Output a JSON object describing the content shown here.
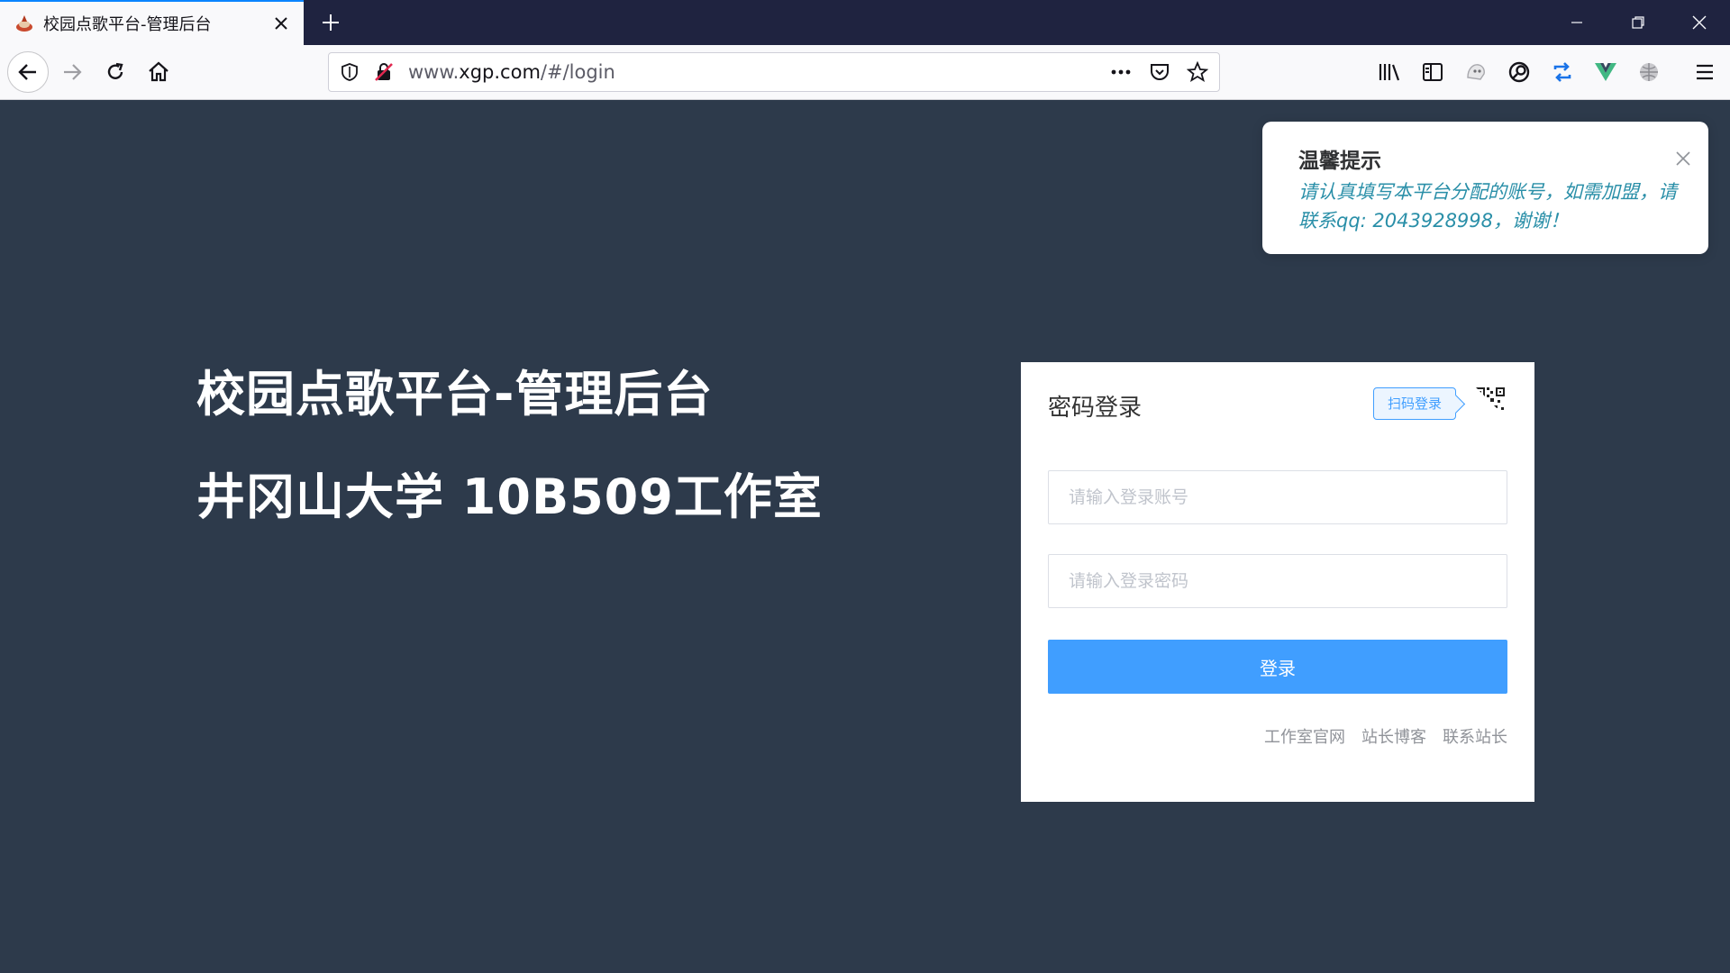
{
  "browser": {
    "tab": {
      "title": "校园点歌平台-管理后台"
    },
    "url": {
      "prefix": "www.",
      "host": "xgp.com",
      "path": "/#/login"
    }
  },
  "page": {
    "hero": {
      "title": "校园点歌平台-管理后台",
      "subtitle": "井冈山大学 10B509工作室"
    },
    "login": {
      "heading": "密码登录",
      "qr_tag": "扫码登录",
      "account_placeholder": "请输入登录账号",
      "password_placeholder": "请输入登录密码",
      "submit_label": "登录",
      "links": [
        "工作室官网",
        "站长博客",
        "联系站长"
      ]
    },
    "notice": {
      "title": "温馨提示",
      "message": "请认真填写本平台分配的账号，如需加盟，请联系qq: 2043928998，谢谢！"
    }
  },
  "colors": {
    "background": "#2d3a4b",
    "primary": "#409eff",
    "notice_text": "#2a8fa8"
  }
}
